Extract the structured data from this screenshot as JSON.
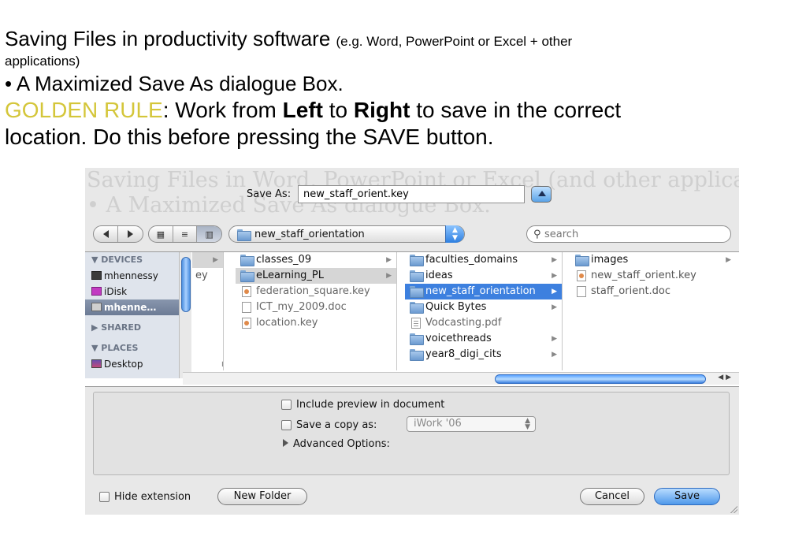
{
  "slide": {
    "title_main": "Saving Files in productivity software ",
    "title_note": "(e.g. Word, PowerPoint or Excel + other",
    "title_note_cont": "applications)",
    "bullet": "• A Maximized Save As dialogue Box.",
    "rule_label": "GOLDEN RULE",
    "rule_text_1": ": Work from ",
    "rule_left": "Left",
    "rule_text_2": " to ",
    "rule_right": "Right",
    "rule_text_3": " to save in the correct",
    "rule_text_4": "location. Do this before pressing the SAVE button.",
    "rule_color": "#d4c63a"
  },
  "dialog": {
    "ghost_line_1": "Saving Files in Word, PowerPoint or Excel (and other applications)",
    "ghost_line_2": "• A Maximized Save As dialogue Box.",
    "save_as_label": "Save As:",
    "save_as_value": "new_staff_orient.key",
    "path_current": "new_staff_orientation",
    "search_placeholder": "search",
    "sidebar": {
      "devices_header": "▼ DEVICES",
      "devices": [
        "mhennessy",
        "iDisk",
        "mhenne…"
      ],
      "shared_header": "▶ SHARED",
      "places_header": "▼ PLACES",
      "places": [
        "Desktop"
      ]
    },
    "col0_tail": "ey",
    "col1": [
      "classes_09",
      "eLearning_PL",
      "federation_square.key",
      "ICT_my_2009.doc",
      "location.key"
    ],
    "col2": [
      "faculties_domains",
      "ideas",
      "new_staff_orientation",
      "Quick Bytes",
      "Vodcasting.pdf",
      "voicethreads",
      "year8_digi_cits"
    ],
    "col3": [
      "images",
      "new_staff_orient.key",
      "staff_orient.doc"
    ],
    "options": {
      "include_preview": "Include preview in document",
      "save_copy_as": "Save a copy as:",
      "version": "iWork '06",
      "advanced": "Advanced Options:"
    },
    "hide_extension": "Hide extension",
    "new_folder": "New Folder",
    "cancel": "Cancel",
    "save": "Save",
    "accent": "#3d80df"
  }
}
